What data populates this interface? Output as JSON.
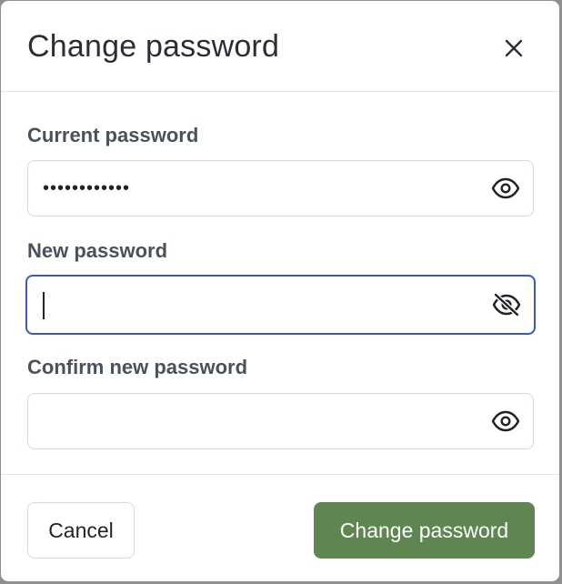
{
  "dialog": {
    "title": "Change password",
    "close_icon": "close-icon"
  },
  "fields": {
    "current": {
      "label": "Current password",
      "value": "••••••••••••",
      "icon": "eye-icon"
    },
    "new": {
      "label": "New password",
      "value": "",
      "icon": "eye-off-icon",
      "focused": true
    },
    "confirm": {
      "label": "Confirm new password",
      "value": "",
      "icon": "eye-icon"
    }
  },
  "footer": {
    "cancel_label": "Cancel",
    "submit_label": "Change password"
  },
  "colors": {
    "primary": "#5f8650",
    "focus_border": "#3b59b6",
    "label_text": "#4a515b",
    "title_text": "#2b2f35"
  }
}
